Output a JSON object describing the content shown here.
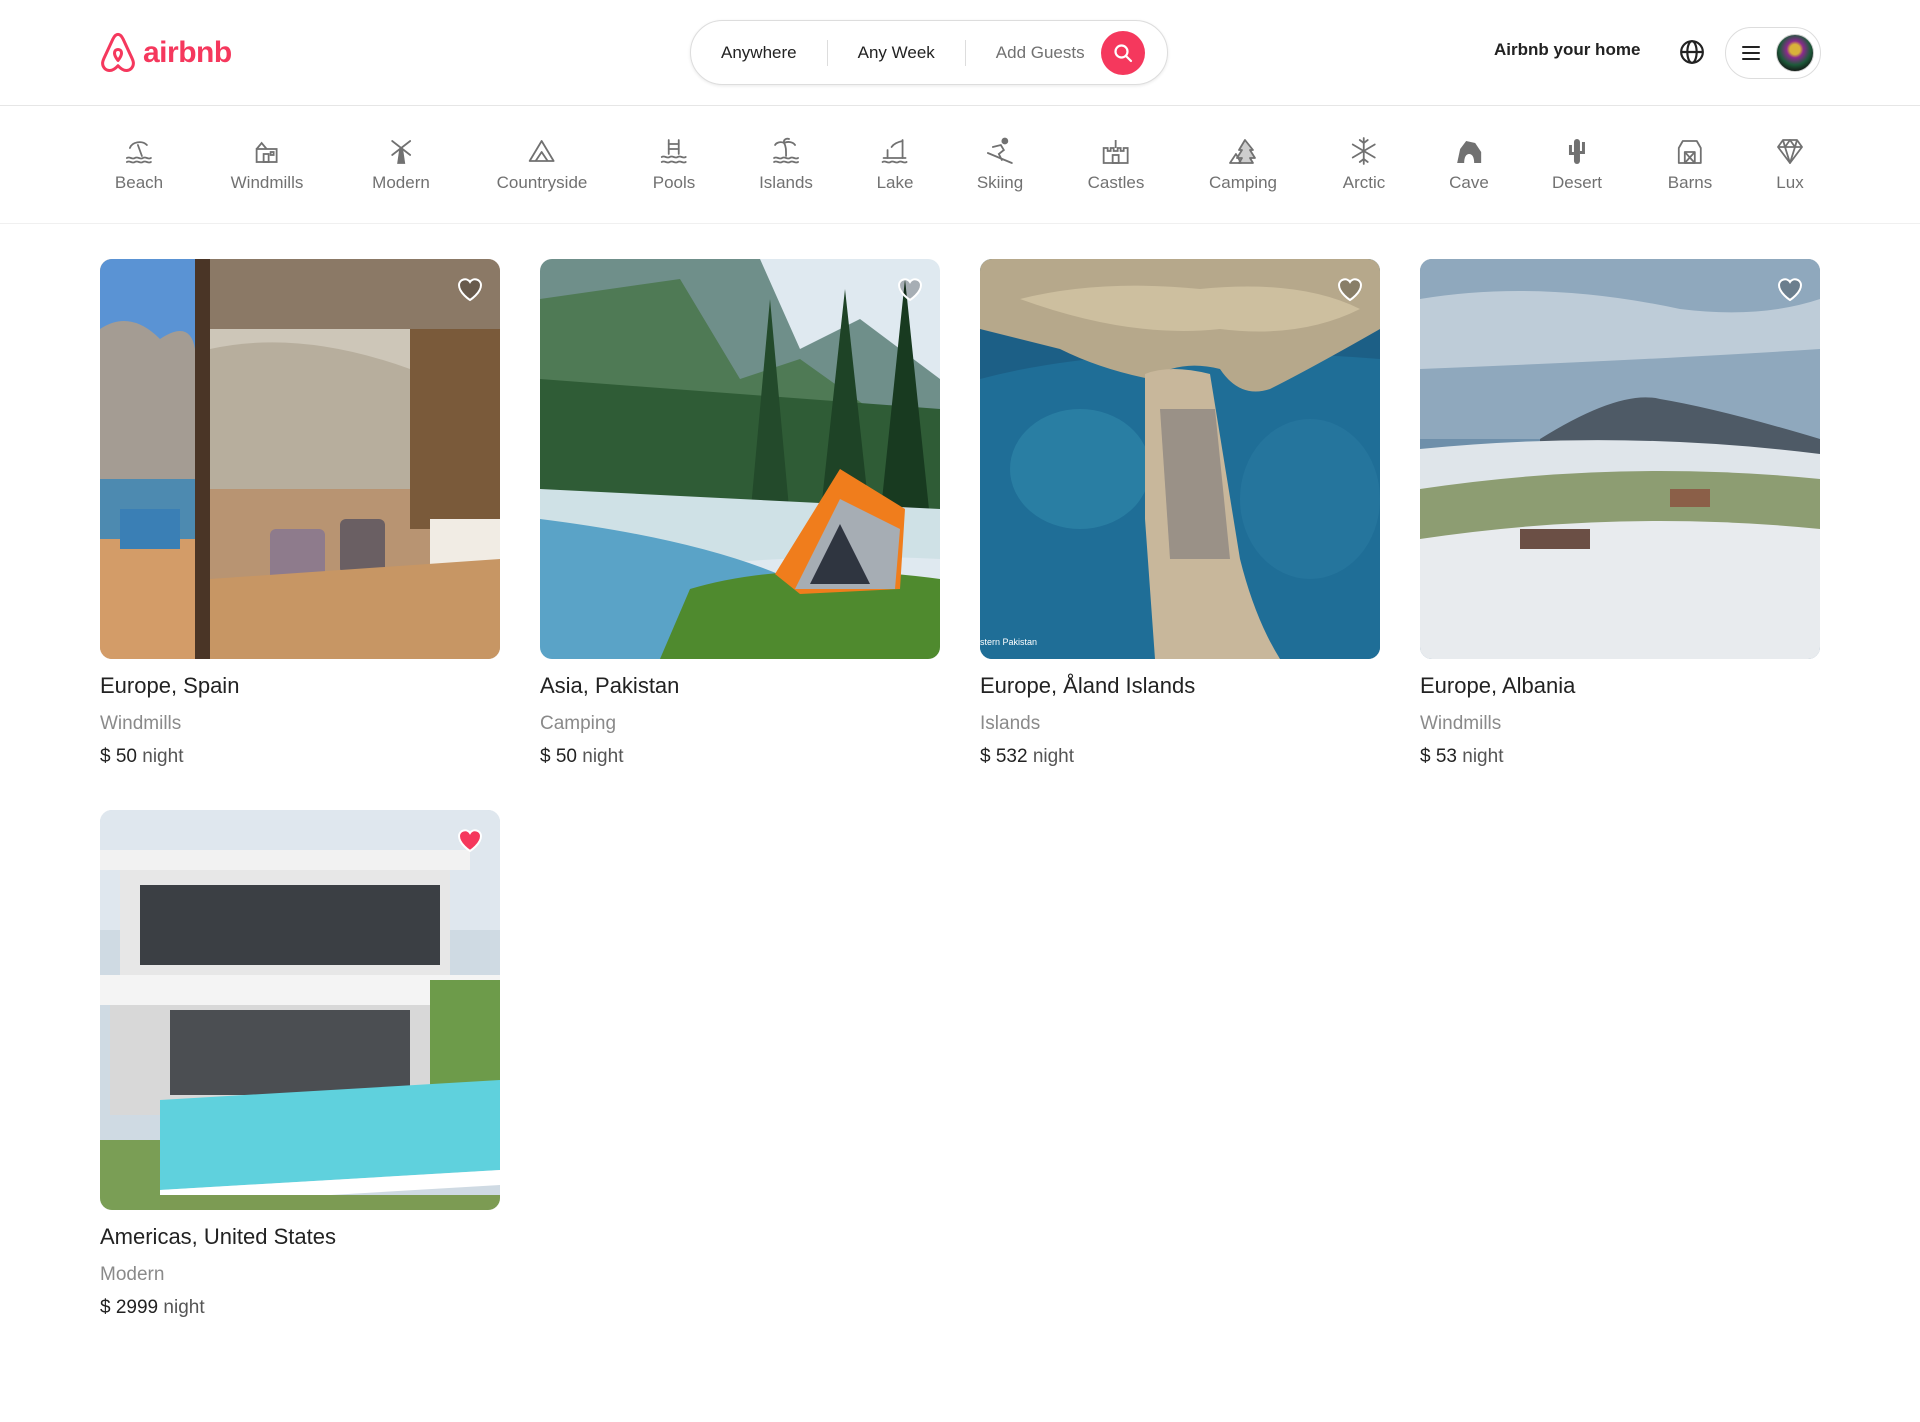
{
  "brand": {
    "name": "airbnb",
    "color": "#F5385D"
  },
  "search": {
    "where": "Anywhere",
    "when": "Any Week",
    "who": "Add Guests",
    "button_icon": "search-icon"
  },
  "nav": {
    "host_link": "Airbnb your home",
    "globe_icon": "globe-icon",
    "menu_icon": "hamburger-icon"
  },
  "categories": [
    {
      "label": "Beach",
      "icon": "beach-icon"
    },
    {
      "label": "Windmills",
      "icon": "windmill-icon"
    },
    {
      "label": "Modern",
      "icon": "modern-icon"
    },
    {
      "label": "Countryside",
      "icon": "mountain-icon"
    },
    {
      "label": "Pools",
      "icon": "pool-icon"
    },
    {
      "label": "Islands",
      "icon": "palm-island-icon"
    },
    {
      "label": "Lake",
      "icon": "lake-icon"
    },
    {
      "label": "Skiing",
      "icon": "skiing-icon"
    },
    {
      "label": "Castles",
      "icon": "castle-icon"
    },
    {
      "label": "Camping",
      "icon": "camping-icon"
    },
    {
      "label": "Arctic",
      "icon": "snowflake-icon"
    },
    {
      "label": "Cave",
      "icon": "cave-icon"
    },
    {
      "label": "Desert",
      "icon": "cactus-icon"
    },
    {
      "label": "Barns",
      "icon": "barn-icon"
    },
    {
      "label": "Lux",
      "icon": "diamond-icon"
    }
  ],
  "listings": [
    {
      "location": "Europe, Spain",
      "category": "Windmills",
      "price": "$ 50",
      "unit": "night",
      "favorited": false
    },
    {
      "location": "Asia, Pakistan",
      "category": "Camping",
      "price": "$ 50",
      "unit": "night",
      "favorited": false
    },
    {
      "location": "Europe, Åland Islands",
      "category": "Islands",
      "price": "$ 532",
      "unit": "night",
      "favorited": false,
      "photo_caption": "stern Pakistan"
    },
    {
      "location": "Europe, Albania",
      "category": "Windmills",
      "price": "$ 53",
      "unit": "night",
      "favorited": false
    },
    {
      "location": "Americas, United States",
      "category": "Modern",
      "price": "$ 2999",
      "unit": "night",
      "favorited": true
    }
  ],
  "colors": {
    "accent": "#F5385D",
    "text": "#222222",
    "muted": "#717171",
    "border": "#DDDDDD"
  }
}
